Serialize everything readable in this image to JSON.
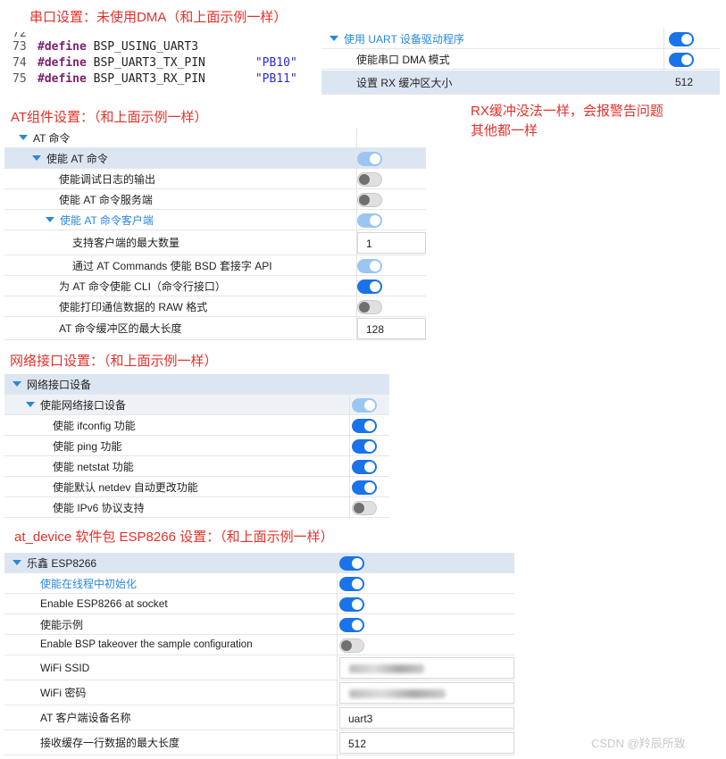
{
  "headings": {
    "uart": "串口设置：未使用DMA（和上面示例一样）",
    "at": "AT组件设置：（和上面示例一样）",
    "net": "网络接口设置：（和上面示例一样）",
    "esp": "at_device 软件包 ESP8266 设置：（和上面示例一样）"
  },
  "note": {
    "line1": "RX缓冲没法一样，会报警告问题",
    "line2": "其他都一样"
  },
  "code": {
    "partial_line": "72",
    "lines": [
      {
        "num": "73",
        "kw": "#define",
        "name": "BSP_USING_UART3",
        "val": ""
      },
      {
        "num": "74",
        "kw": "#define",
        "name": "BSP_UART3_TX_PIN",
        "val": "\"PB10\""
      },
      {
        "num": "75",
        "kw": "#define",
        "name": "BSP_UART3_RX_PIN",
        "val": "\"PB11\""
      }
    ]
  },
  "uart_panel": {
    "header": "使用 UART 设备驱动程序",
    "dma": "使能串口 DMA 模式",
    "rx_buf": "设置 RX 缓冲区大小",
    "rx_buf_value": "512"
  },
  "at_panel": {
    "root": "AT 命令",
    "enable": "使能 AT 命令",
    "debug": "使能调试日志的输出",
    "server": "使能 AT 命令服务端",
    "client": "使能 AT 命令客户端",
    "max_clients": "支持客户端的最大数量",
    "max_clients_value": "1",
    "bsd": "通过 AT Commands 使能 BSD 套接字 API",
    "cli": "为 AT 命令使能 CLI（命令行接口）",
    "raw": "使能打印通信数据的 RAW 格式",
    "buf_len": "AT 命令缓冲区的最大长度",
    "buf_len_value": "128"
  },
  "net_panel": {
    "root": "网络接口设备",
    "enable": "使能网络接口设备",
    "ifconfig": "使能 ifconfig 功能",
    "ping": "使能 ping 功能",
    "netstat": "使能 netstat 功能",
    "netdev_auto": "使能默认 netdev 自动更改功能",
    "ipv6": "使能 IPv6 协议支持"
  },
  "esp_panel": {
    "root": "乐鑫 ESP8266",
    "thread_init": "使能在线程中初始化",
    "socket": "Enable ESP8266 at socket",
    "sample": "使能示例",
    "takeover": "Enable BSP takeover the sample configuration",
    "ssid": "WiFi SSID",
    "password": "WiFi 密码",
    "client_name": "AT 客户端设备名称",
    "client_name_value": "uart3",
    "recv_line": "接收缓存一行数据的最大长度",
    "recv_line_value": "512"
  },
  "watermark": "CSDN @羚辰所致",
  "colors": {
    "heading_red": "#e5302a",
    "toggle_on": "#1a73e8",
    "selection": "#dce6f2",
    "tree_blue": "#2b88d8"
  }
}
